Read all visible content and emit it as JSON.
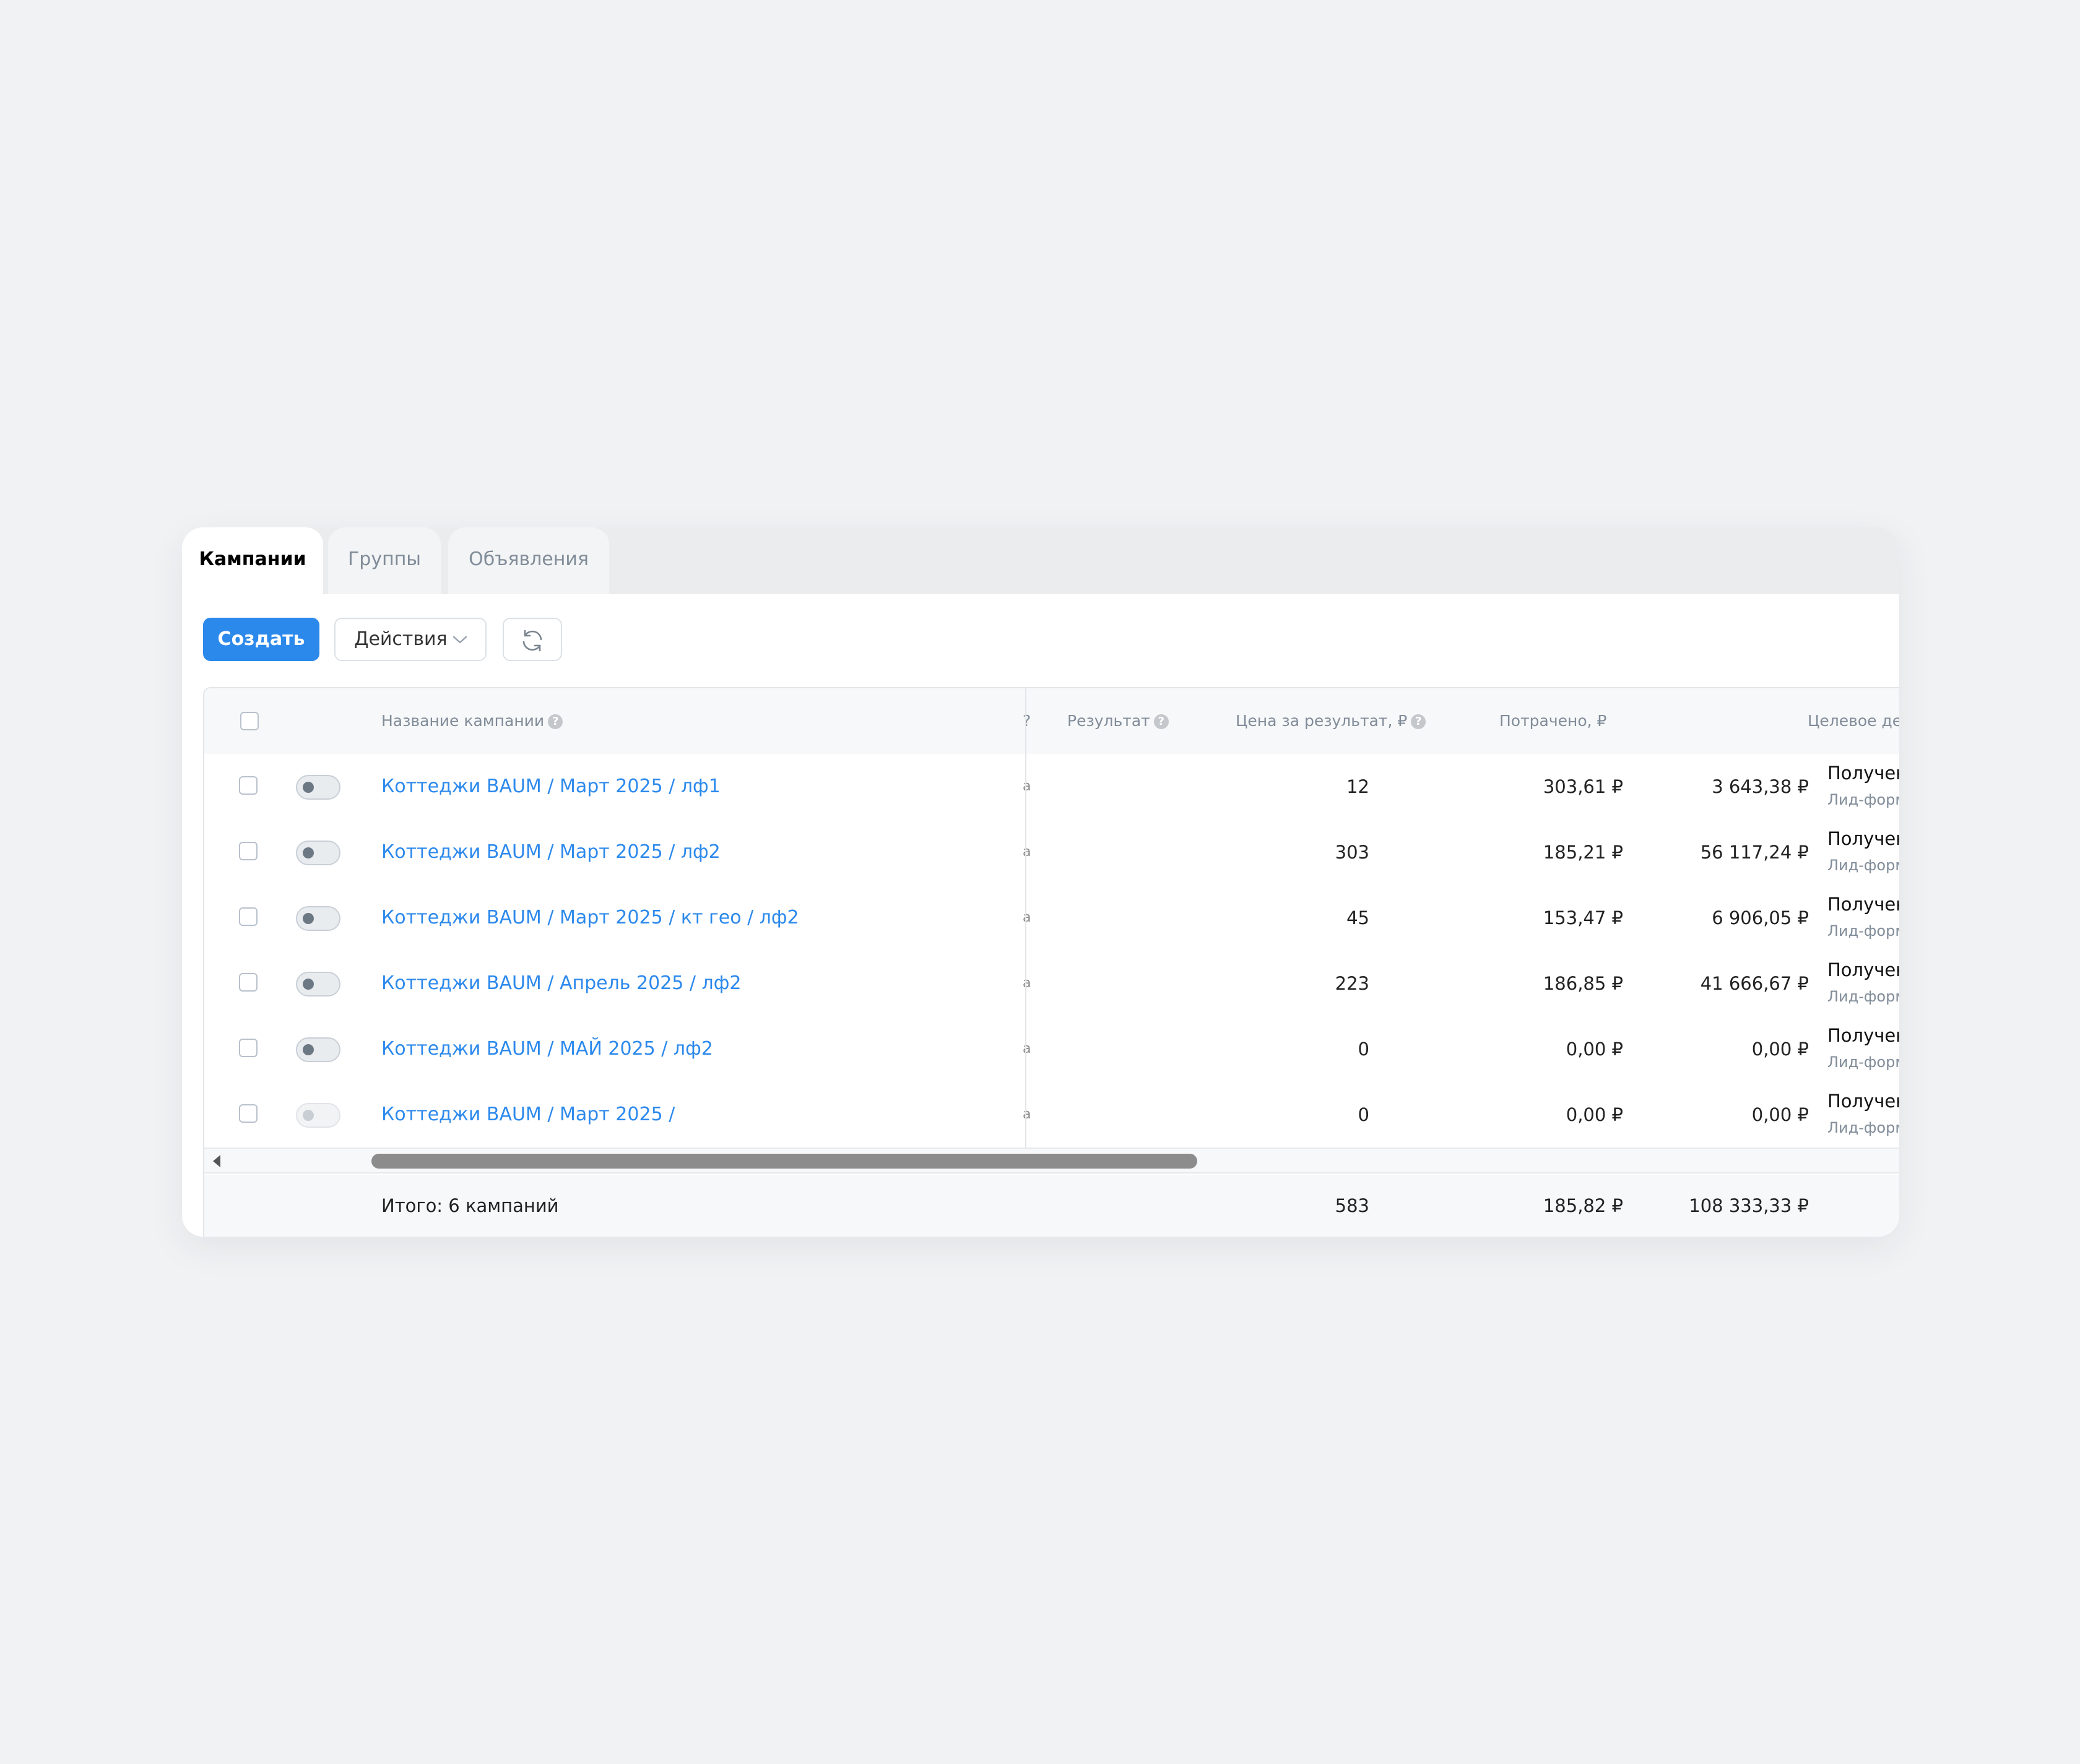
{
  "tabs": [
    {
      "label": "Кампании",
      "active": true
    },
    {
      "label": "Группы",
      "active": false
    },
    {
      "label": "Объявления",
      "active": false
    }
  ],
  "toolbar": {
    "create_label": "Создать",
    "actions_label": "Действия",
    "actions_icon": "chevron-down-icon",
    "refresh_icon": "refresh-icon"
  },
  "columns": {
    "name": "Название кампании",
    "clipped": "?",
    "result": "Результат",
    "price": "Цена за результат, ₽",
    "spent": "Потрачено, ₽",
    "goal": "Целевое действие",
    "help_icon": "help-icon"
  },
  "rows": [
    {
      "name": "Коттеджи BAUM / Март 2025 / лф1",
      "cut": "a",
      "result": "12",
      "price": "303,61 ₽",
      "spent": "3 643,38 ₽",
      "goal": "Получение лидов",
      "goal_sub": "Лид-формы",
      "active": true
    },
    {
      "name": "Коттеджи BAUM / Март 2025 / лф2",
      "cut": "a",
      "result": "303",
      "price": "185,21 ₽",
      "spent": "56 117,24 ₽",
      "goal": "Получение лидов",
      "goal_sub": "Лид-формы",
      "active": true
    },
    {
      "name": "Коттеджи BAUM / Март 2025 / кт гео / лф2",
      "cut": "a",
      "result": "45",
      "price": "153,47 ₽",
      "spent": "6 906,05 ₽",
      "goal": "Получение лидов",
      "goal_sub": "Лид-формы",
      "active": true
    },
    {
      "name": "Коттеджи BAUM / Апрель 2025 / лф2",
      "cut": "a",
      "result": "223",
      "price": "186,85 ₽",
      "spent": "41 666,67 ₽",
      "goal": "Получение лидов",
      "goal_sub": "Лид-формы",
      "active": true
    },
    {
      "name": "Коттеджи BAUM / МАЙ 2025 / лф2",
      "cut": "a",
      "result": "0",
      "price": "0,00 ₽",
      "spent": "0,00 ₽",
      "goal": "Получение лидов",
      "goal_sub": "Лид-формы",
      "active": true
    },
    {
      "name": "Коттеджи BAUM / Март 2025 /",
      "cut": "a",
      "result": "0",
      "price": "0,00 ₽",
      "spent": "0,00 ₽",
      "goal": "Получение лидов",
      "goal_sub": "Лид-формы",
      "active": false
    }
  ],
  "totals": {
    "label": "Итого: 6 кампаний",
    "result": "583",
    "price": "185,82 ₽",
    "spent": "108 333,33 ₽"
  },
  "colors": {
    "accent": "#2c89ec",
    "background": "#f1f2f4",
    "muted_text": "#818c99"
  }
}
